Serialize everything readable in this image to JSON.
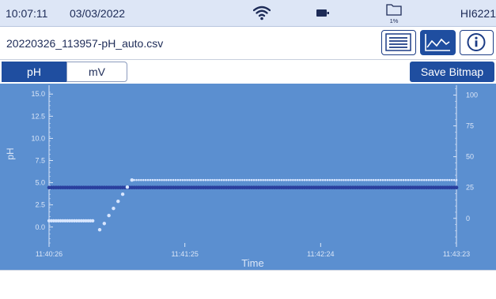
{
  "status": {
    "time": "10:07:11",
    "date": "03/03/2022",
    "storage": "1%",
    "model": "HI6221"
  },
  "file": {
    "name": "20220326_113957-pH_auto.csv"
  },
  "toolbar": {
    "icons": [
      "list-icon",
      "chart-icon",
      "info-icon"
    ],
    "active": "chart-icon"
  },
  "tabs": {
    "ph_label": "pH",
    "mv_label": "mV",
    "selected": "pH"
  },
  "save_bitmap_label": "Save Bitmap",
  "colors": {
    "accent": "#1f4ea0",
    "plot_background": "#5b8fd0",
    "series_ph": "#d8e6ff",
    "series_mv": "#2a3f9e"
  },
  "chart_data": {
    "type": "scatter",
    "xlabel": "Time",
    "ylabel": "pH",
    "x_ticks": [
      "11:40:26",
      "11:41:25",
      "11:42:24",
      "11:43:23"
    ],
    "y_ticks": [
      "0.0",
      "2.5",
      "5.0",
      "7.5",
      "10.0",
      "12.5",
      "15.0"
    ],
    "y_right_ticks": [
      "0",
      "25",
      "50",
      "75",
      "100"
    ],
    "xlim": [
      "11:40:26",
      "11:43:23"
    ],
    "ylim": [
      -1.8,
      16.0
    ],
    "y_right_lim": [
      -20,
      108
    ],
    "series": [
      {
        "axis": "left",
        "points": [
          [
            "11:40:26",
            0.7
          ],
          [
            "11:40:29",
            0.7
          ],
          [
            "11:40:32",
            0.7
          ],
          [
            "11:40:35",
            0.7
          ],
          [
            "11:40:38",
            0.7
          ],
          [
            "11:40:41",
            0.7
          ],
          [
            "11:40:44",
            0.7
          ],
          [
            "11:40:46",
            0.7
          ],
          [
            "11:40:48",
            -0.3
          ],
          [
            "11:40:50",
            0.4
          ],
          [
            "11:40:52",
            1.3
          ],
          [
            "11:40:54",
            2.1
          ],
          [
            "11:40:56",
            2.9
          ],
          [
            "11:40:58",
            3.7
          ],
          [
            "11:41:00",
            4.5
          ],
          [
            "11:41:02",
            5.3
          ],
          [
            "11:41:30",
            5.3
          ],
          [
            "11:42:00",
            5.3
          ],
          [
            "11:42:30",
            5.3
          ],
          [
            "11:43:00",
            5.3
          ],
          [
            "11:43:23",
            5.3
          ]
        ]
      },
      {
        "axis": "right",
        "points": [
          [
            "11:40:26",
            25
          ],
          [
            "11:41:00",
            25
          ],
          [
            "11:41:30",
            25
          ],
          [
            "11:42:00",
            25
          ],
          [
            "11:42:30",
            25
          ],
          [
            "11:43:00",
            25
          ],
          [
            "11:43:23",
            25
          ]
        ]
      }
    ]
  }
}
